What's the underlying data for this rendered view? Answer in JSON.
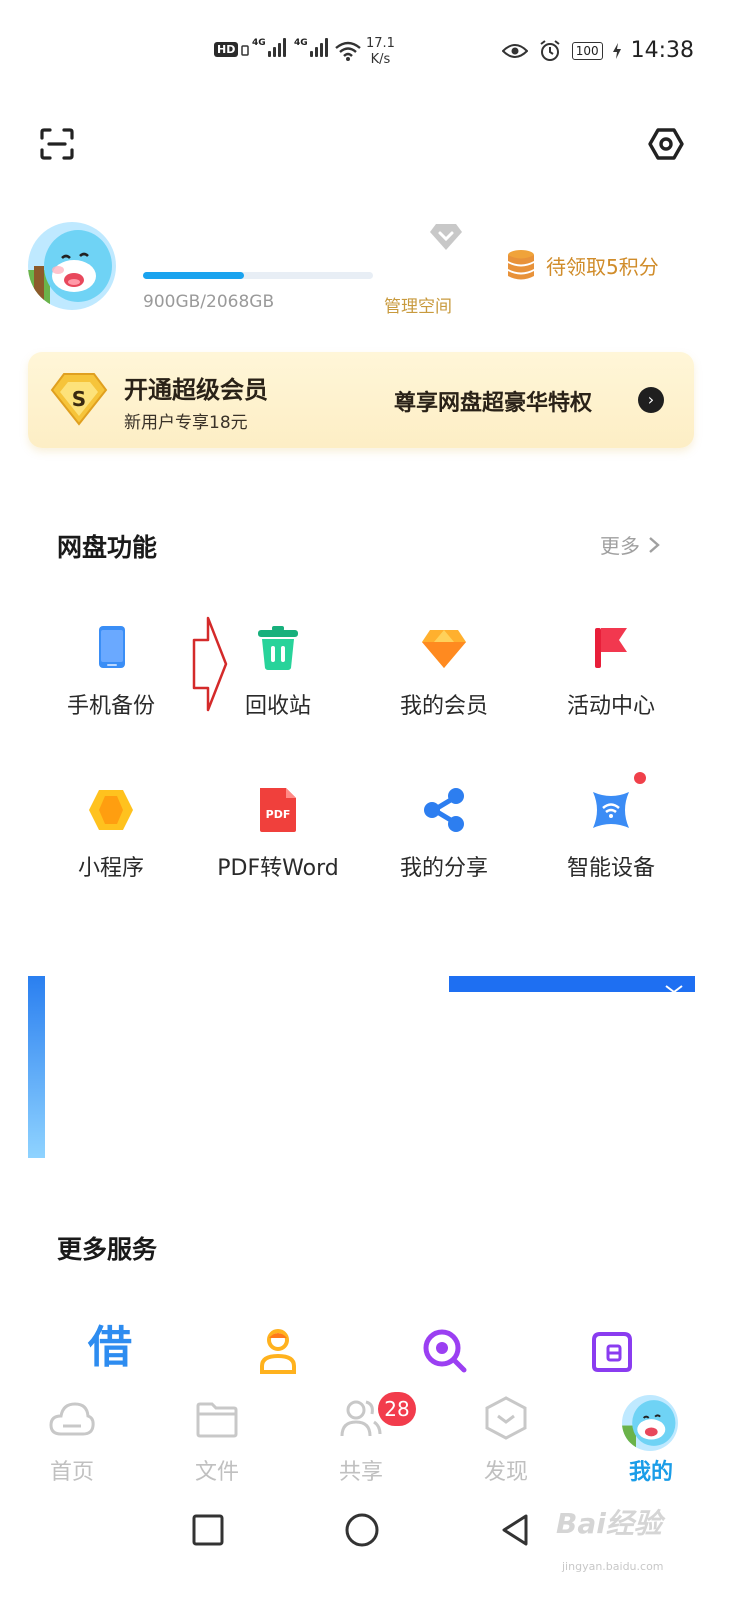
{
  "status_bar": {
    "hd": "HD",
    "net1": "4G",
    "net2": "4G",
    "speed_value": "17.1",
    "speed_unit": "K/s",
    "battery": "100",
    "time": "14:38"
  },
  "profile": {
    "storage_used_fraction": 0.44,
    "storage_text": "900GB/2068GB",
    "manage_space": "管理空间",
    "points_text": "待领取5积分"
  },
  "vip": {
    "title": "开通超级会员",
    "subtitle": "新用户专享18元",
    "promo": "尊享网盘超豪华特权",
    "badge_letter": "S"
  },
  "features": {
    "title": "网盘功能",
    "more": "更多",
    "items": [
      {
        "label": "手机备份",
        "icon": "phone-backup-icon",
        "color": "#3a8ef6"
      },
      {
        "label": "回收站",
        "icon": "trash-icon",
        "color": "#1fc48c"
      },
      {
        "label": "我的会员",
        "icon": "diamond-icon",
        "color": "#ffb02e"
      },
      {
        "label": "活动中心",
        "icon": "flag-icon",
        "color": "#f2384f"
      },
      {
        "label": "小程序",
        "icon": "mini-program-icon",
        "color": "#ffc21e"
      },
      {
        "label": "PDF转Word",
        "icon": "pdf-icon",
        "color": "#f0403c"
      },
      {
        "label": "我的分享",
        "icon": "share-icon",
        "color": "#2d7ef0"
      },
      {
        "label": "智能设备",
        "icon": "smart-device-icon",
        "color": "#3b8cf5"
      }
    ],
    "pdf_icon_text": "PDF"
  },
  "services": {
    "title": "更多服务",
    "jie": "借"
  },
  "tabbar": {
    "items": [
      {
        "label": "首页",
        "icon": "cloud-icon"
      },
      {
        "label": "文件",
        "icon": "folder-icon"
      },
      {
        "label": "共享",
        "icon": "people-icon"
      },
      {
        "label": "发现",
        "icon": "discover-icon"
      },
      {
        "label": "我的",
        "icon": "avatar"
      }
    ],
    "badge": "28",
    "active": "我的"
  },
  "watermark": {
    "text": "Bai经验",
    "sub": "jingyan.baidu.com"
  }
}
